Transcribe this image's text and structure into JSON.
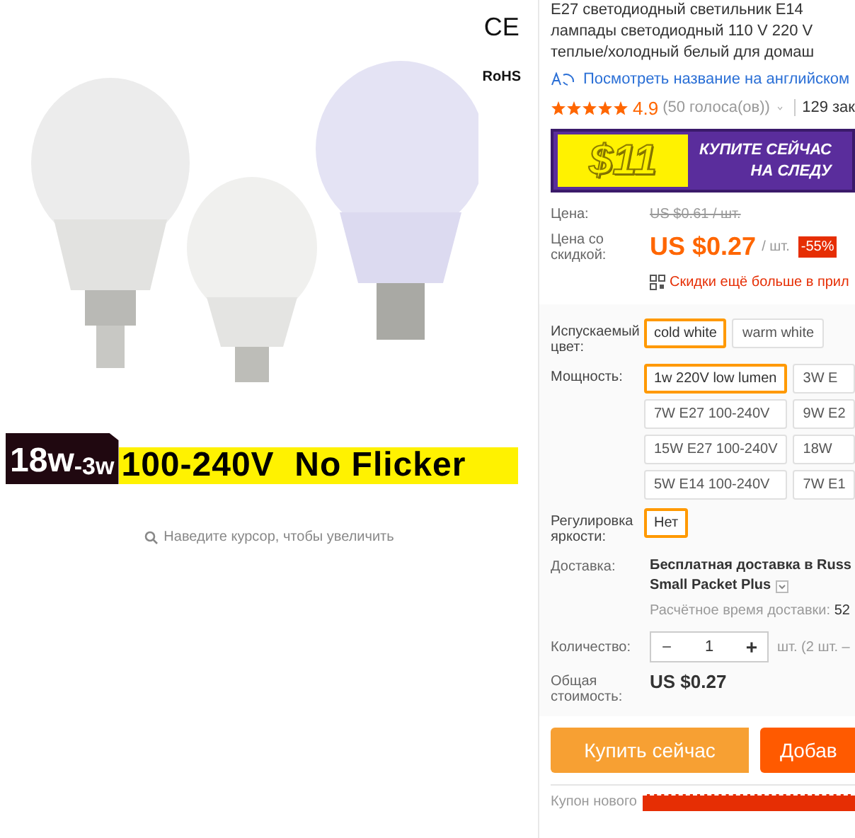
{
  "product_image": {
    "marks": [
      "CE",
      "RoHS"
    ],
    "banner": {
      "wattage": "18w",
      "wattage_small": "-3w",
      "text": "100-240V  No Flicker"
    },
    "hint": "Наведите курсор, чтобы увеличить"
  },
  "title_lines": [
    "E27 светодиодный светильник E14",
    "лампады светодиодный 110 V 220 V",
    "теплые/холодный белый для домаш"
  ],
  "translate_link": "Посмотреть название на английском",
  "rating": {
    "stars": 5,
    "score": "4.9",
    "votes": "(50 голоса(ов))",
    "orders": "129 зак"
  },
  "promo": {
    "amount": "$11",
    "line_1": "КУПИТЕ СЕЙЧАС",
    "line_2": "НА СЛЕДУ"
  },
  "price": {
    "label": "Цена:",
    "old": "US $0.61 / шт.",
    "discount_label": "Цена со скидкой:",
    "value": "US $0.27",
    "unit": "/ шт.",
    "badge": "-55%",
    "app_note": "Скидки ещё больше в прил"
  },
  "option_groups": [
    {
      "label": "Испускаемый цвет:",
      "options": [
        {
          "label": "cold white",
          "selected": true
        },
        {
          "label": "warm white",
          "selected": false
        }
      ]
    },
    {
      "label": "Мощность:",
      "options": [
        {
          "label": "1w 220V low lumen",
          "selected": true
        },
        {
          "label": "3W E",
          "selected": false
        },
        {
          "label": "7W E27 100-240V",
          "selected": false
        },
        {
          "label": "9W E2",
          "selected": false
        },
        {
          "label": "15W E27 100-240V",
          "selected": false
        },
        {
          "label": "18W",
          "selected": false
        },
        {
          "label": "5W E14 100-240V",
          "selected": false
        },
        {
          "label": "7W E1",
          "selected": false
        }
      ]
    },
    {
      "label": "Регулировка яркости:",
      "options": [
        {
          "label": "Нет",
          "selected": true
        }
      ]
    }
  ],
  "delivery": {
    "label": "Доставка:",
    "line_1": "Бесплатная доставка в Russ",
    "line_2": "Small Packet Plus",
    "estimate": "Расчётное время доставки:",
    "estimate_value": "52"
  },
  "quantity": {
    "label": "Количество:",
    "minus": "−",
    "value": "1",
    "plus": "+",
    "note": "шт. (2 шт. –"
  },
  "total": {
    "label": "Общая стоимость:",
    "value": "US $0.27"
  },
  "buttons": [
    {
      "label": "Купить сейчас",
      "kind": "buy"
    },
    {
      "label": "Добав",
      "kind": "cart"
    }
  ],
  "coupon": {
    "label": "Купон нового"
  }
}
